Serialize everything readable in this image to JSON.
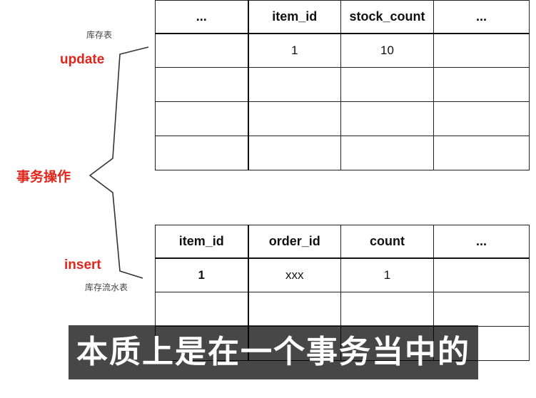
{
  "stock_table": {
    "name": "库存表",
    "headers": [
      "...",
      "item_id",
      "stock_count",
      "..."
    ],
    "rows": [
      [
        "",
        "1",
        "10",
        ""
      ],
      [
        "",
        "",
        "",
        ""
      ],
      [
        "",
        "",
        "",
        ""
      ],
      [
        "",
        "",
        "",
        ""
      ]
    ]
  },
  "flow_table": {
    "name": "库存流水表",
    "headers": [
      "item_id",
      "order_id",
      "count",
      "..."
    ],
    "rows": [
      [
        "1",
        "xxx",
        "1",
        ""
      ],
      [
        "",
        "",
        "",
        ""
      ],
      [
        "",
        "",
        "",
        ""
      ]
    ]
  },
  "labels": {
    "update": "update",
    "insert": "insert",
    "transaction": "事务操作"
  },
  "subtitle": "本质上是在一个事务当中的",
  "colors": {
    "accent": "#e0251b",
    "subtitle_bg": "#000000"
  }
}
